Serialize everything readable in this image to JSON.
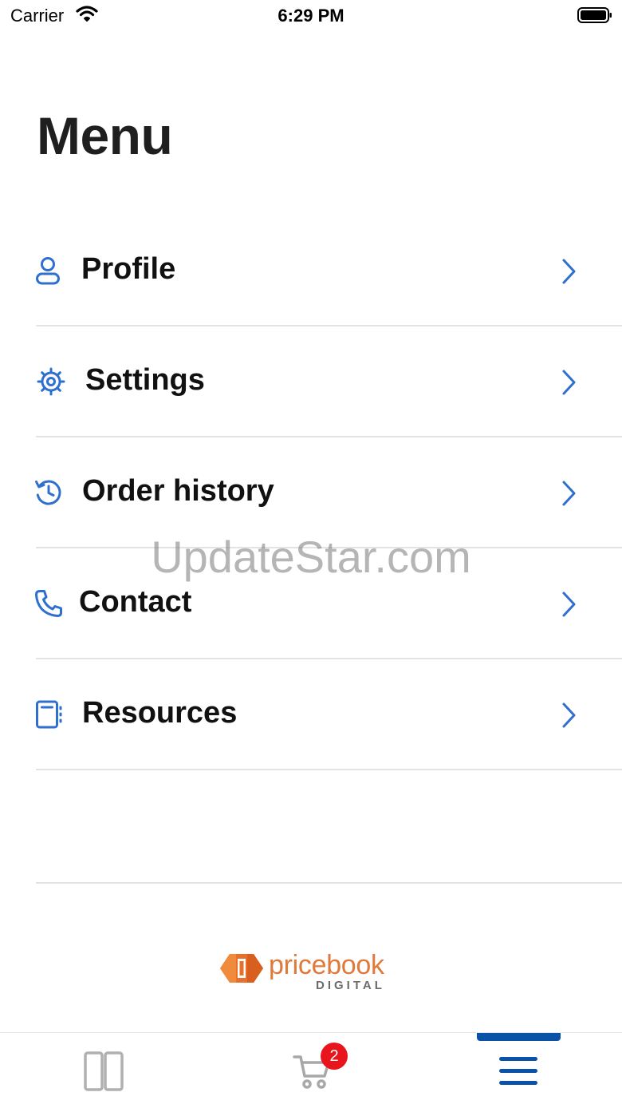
{
  "status_bar": {
    "carrier": "Carrier",
    "time": "6:29 PM"
  },
  "page": {
    "title": "Menu"
  },
  "menu": {
    "items": [
      {
        "label": "Profile",
        "icon": "user-icon"
      },
      {
        "label": "Settings",
        "icon": "gear-icon"
      },
      {
        "label": "Order history",
        "icon": "history-icon"
      },
      {
        "label": "Contact",
        "icon": "phone-icon"
      },
      {
        "label": "Resources",
        "icon": "notebook-icon"
      }
    ]
  },
  "logo": {
    "name": "pricebook",
    "sub": "DIGITAL"
  },
  "watermark": "UpdateStar.com",
  "tabs": {
    "items": [
      {
        "icon": "catalog-icon"
      },
      {
        "icon": "cart-icon",
        "badge": "2"
      },
      {
        "icon": "hamburger-menu-icon",
        "selected": true
      }
    ]
  },
  "colors": {
    "accent": "#0a52a8",
    "icon_blue": "#2f6fcf",
    "badge": "#e8151c",
    "logo_orange": "#e07a3a"
  }
}
